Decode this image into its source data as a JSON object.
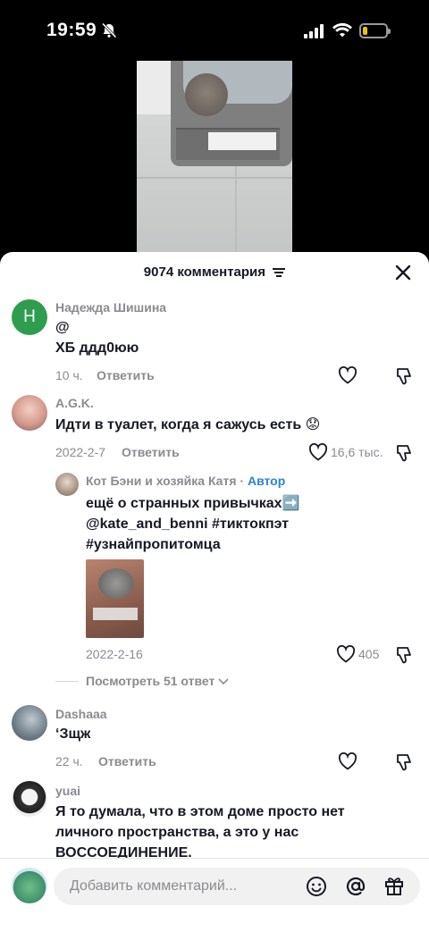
{
  "status_bar": {
    "time": "19:59"
  },
  "comments_header": {
    "title": "9074 комментария"
  },
  "comments": [
    {
      "user": "Надежда Шишина",
      "avatar_letter": "Н",
      "text_lines": [
        "@",
        "ХБ ддд0юю"
      ],
      "time": "10 ч.",
      "reply_label": "Ответить"
    },
    {
      "user": "A.G.K.",
      "text_lines": [
        "Идти в туалет, когда я сажусь есть 😟"
      ],
      "time": "2022-2-7",
      "reply_label": "Ответить",
      "likes": "16,6 тыс."
    },
    {
      "user": "Кот Бэни и хозяйка Катя",
      "author_badge": "Автор",
      "separator": " · ",
      "text_lines": [
        "ещё о странных привычках➡️",
        "@kate_and_benni #тиктокпэт",
        "#узнайпропитомца"
      ],
      "time": "2022-2-16",
      "likes": "405"
    },
    {
      "user": "Dashaaa",
      "text_lines": [
        "‘Зщж"
      ],
      "time": "22 ч.",
      "reply_label": "Ответить"
    },
    {
      "user": "yuai",
      "text_lines": [
        "Я то думала, что в этом доме просто нет",
        "личного пространства, а это у нас",
        "ВОССОЕДИНЕНИЕ."
      ]
    }
  ],
  "view_replies": {
    "label": "Посмотреть 51 ответ"
  },
  "comment_input": {
    "placeholder": "Добавить комментарий..."
  },
  "icons": [
    "bell-muted-icon",
    "signal-icon",
    "wifi-icon",
    "battery-icon",
    "sort-icon",
    "close-icon",
    "heart-icon",
    "dislike-icon",
    "chevron-down-icon",
    "emoji-icon",
    "mention-icon",
    "gift-icon"
  ],
  "colors": {
    "author_badge": "#2c83d8",
    "battery": "#f2c200",
    "avatar_letter_bg": "#2e9e4e"
  }
}
